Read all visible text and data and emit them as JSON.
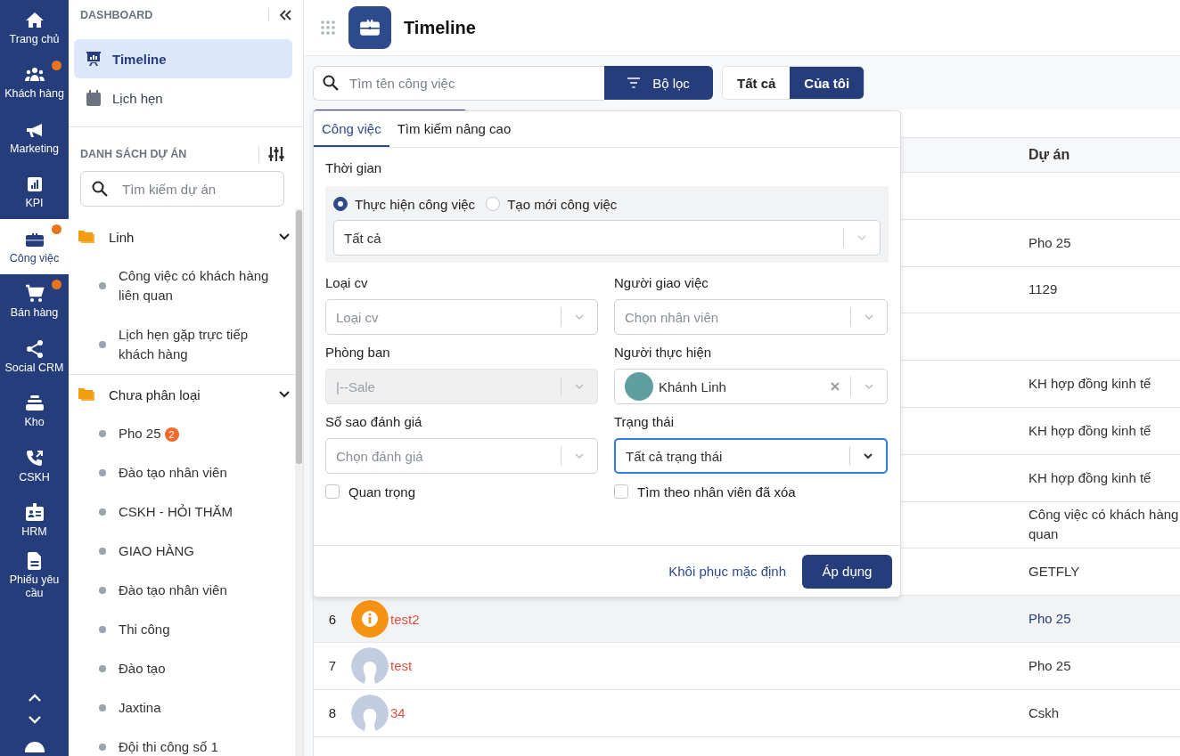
{
  "rail": {
    "items": [
      {
        "label": "Trang chủ",
        "badge": false,
        "selected": false
      },
      {
        "label": "Khách hàng",
        "badge": true,
        "selected": false
      },
      {
        "label": "Marketing",
        "badge": false,
        "selected": false
      },
      {
        "label": "KPI",
        "badge": false,
        "selected": false
      },
      {
        "label": "Công việc",
        "badge": true,
        "selected": true
      },
      {
        "label": "Bán hàng",
        "badge": true,
        "selected": false
      },
      {
        "label": "Social CRM",
        "badge": false,
        "selected": false
      },
      {
        "label": "Kho",
        "badge": false,
        "selected": false
      },
      {
        "label": "CSKH",
        "badge": false,
        "selected": false
      },
      {
        "label": "HRM",
        "badge": false,
        "selected": false
      },
      {
        "label": "Phiếu yêu cầu",
        "badge": false,
        "selected": false
      }
    ]
  },
  "sidebar": {
    "dashboard_heading": "DASHBOARD",
    "dashboard_items": [
      {
        "label": "Timeline",
        "selected": true
      },
      {
        "label": "Lịch hẹn",
        "selected": false
      }
    ],
    "projects_heading": "DANH SÁCH DỰ ÁN",
    "project_search": {
      "placeholder": "Tìm kiếm dự án"
    },
    "groups": [
      {
        "name": "Linh",
        "expanded": true,
        "children": [
          {
            "label": "Công việc có khách hàng liên quan"
          },
          {
            "label": "Lịch hẹn gặp trực tiếp khách hàng"
          }
        ]
      },
      {
        "name": "Chưa phân loại",
        "expanded": true,
        "children": [
          {
            "label": "Pho 25",
            "badge": "2"
          },
          {
            "label": "Đào tạo nhân viên"
          },
          {
            "label": "CSKH - HỎI THĂM"
          },
          {
            "label": "GIAO HÀNG"
          },
          {
            "label": "Đào tạo nhân viên"
          },
          {
            "label": "Thi công"
          },
          {
            "label": "Đào tạo"
          },
          {
            "label": "Jaxtina"
          },
          {
            "label": "Đội thi công số 1"
          }
        ]
      }
    ]
  },
  "header": {
    "title": "Timeline"
  },
  "toolbar": {
    "search": {
      "placeholder": "Tìm tên công việc"
    },
    "filter_button": "Bộ lọc",
    "scope_tabs": [
      {
        "label": "Tất cả",
        "selected": false
      },
      {
        "label": "Của tôi",
        "selected": true
      }
    ]
  },
  "table": {
    "columns": [
      "Dự án"
    ],
    "rows": [
      {},
      {
        "project": "Pho 25"
      },
      {
        "project": "1129"
      },
      {},
      {
        "project": "KH hợp đồng kinh tế"
      },
      {
        "project": "KH hợp đồng kinh tế"
      },
      {
        "project": "KH hợp đồng kinh tế"
      },
      {
        "project": "Công việc có khách hàng quan"
      },
      {
        "project": "GETFLY"
      },
      {
        "number": "6",
        "kind": "alert",
        "task": "test2",
        "project": "Pho 25",
        "selected": true
      },
      {
        "number": "7",
        "kind": "person",
        "task": "test",
        "project": "Pho 25",
        "selected": false
      },
      {
        "number": "8",
        "kind": "person",
        "task": "34",
        "project": "Cskh",
        "selected": false
      }
    ]
  },
  "filter_panel": {
    "tabs": [
      {
        "label": "Công việc",
        "selected": true
      },
      {
        "label": "Tìm kiếm nâng cao",
        "selected": false
      }
    ],
    "time": {
      "label": "Thời gian",
      "options": [
        {
          "label": "Thực hiện công việc",
          "selected": true
        },
        {
          "label": "Tạo mới công việc",
          "selected": false
        }
      ],
      "range": "Tất cả"
    },
    "fields": [
      {
        "label": "Loại cv",
        "placeholder": "Loại cv",
        "disabled": false,
        "focused": false
      },
      {
        "label": "Người giao việc",
        "placeholder": "Chọn nhân viên",
        "disabled": false,
        "focused": false
      },
      {
        "label": "Phòng ban",
        "value": "|--Sale",
        "disabled": true,
        "focused": false
      },
      {
        "label": "Người thực hiện",
        "value": "Khánh Linh",
        "avatar": true,
        "clearable": true,
        "disabled": false,
        "focused": false
      },
      {
        "label": "Số sao đánh giá",
        "placeholder": "Chọn đánh giá",
        "disabled": false,
        "focused": false
      },
      {
        "label": "Trạng thái",
        "value": "Tất cả trạng thái",
        "disabled": false,
        "focused": true
      }
    ],
    "checkboxes": [
      {
        "label": "Quan trọng",
        "checked": false
      },
      {
        "label": "Tìm theo nhân viên đã xóa",
        "checked": false
      }
    ],
    "reset": "Khôi phục mặc định",
    "apply": "Áp dụng"
  }
}
